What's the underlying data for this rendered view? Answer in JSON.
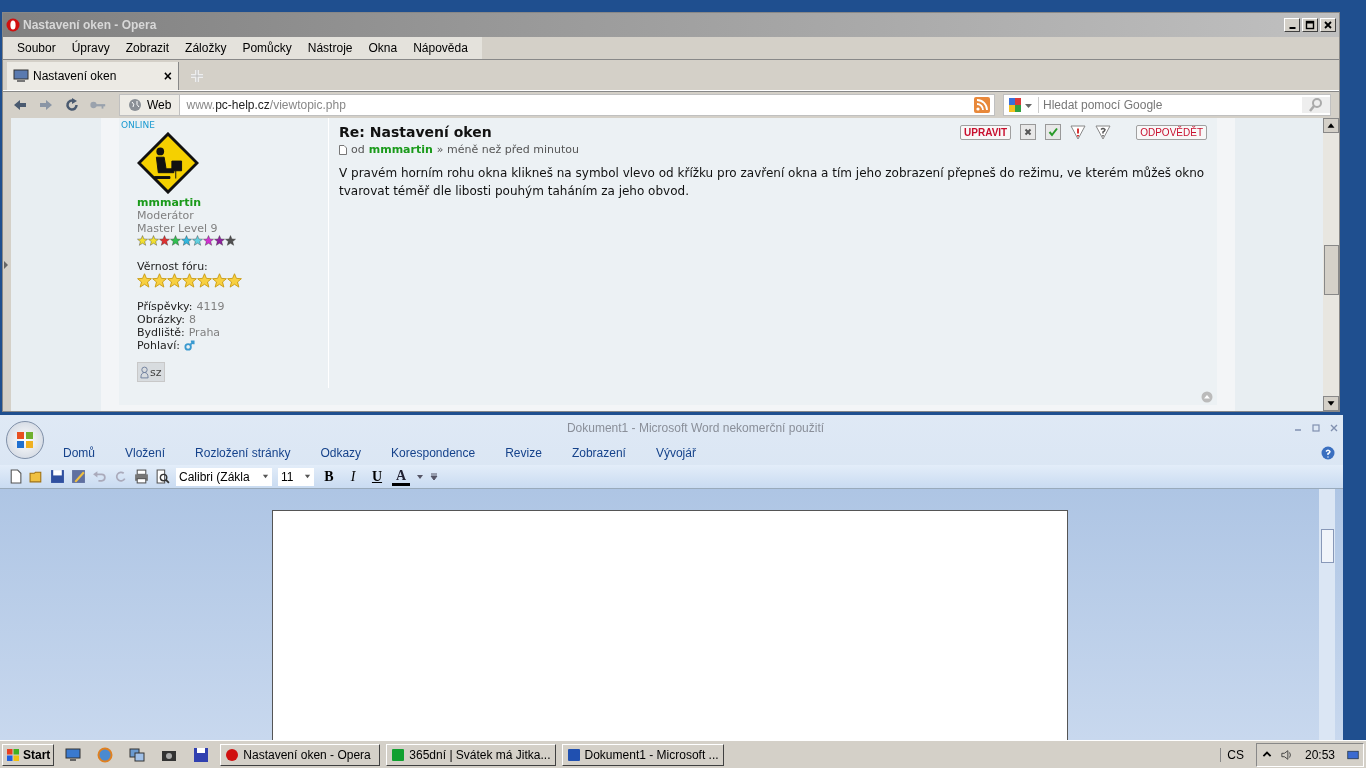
{
  "opera": {
    "title": "Nastavení oken - Opera",
    "menu": [
      "Soubor",
      "Úpravy",
      "Zobrazit",
      "Záložky",
      "Pomůcky",
      "Nástroje",
      "Okna",
      "Nápověda"
    ],
    "tab": {
      "label": "Nastavení oken",
      "close": "×"
    },
    "address": {
      "badge": "Web",
      "host_prefix": "www.",
      "host": "pc-help.cz",
      "path": "/viewtopic.php"
    },
    "search": {
      "placeholder": "Hledat pomocí Google"
    },
    "post": {
      "online": "ONLINE",
      "username": "mmmartin",
      "role": "Moderátor",
      "rank": "Master Level 9",
      "rank_stars": [
        {
          "color": "#f2e030"
        },
        {
          "color": "#f2e030"
        },
        {
          "color": "#e03030"
        },
        {
          "color": "#30c050"
        },
        {
          "color": "#30b8e0"
        },
        {
          "color": "#60d0e0"
        },
        {
          "color": "#d030d0"
        },
        {
          "color": "#9020a0"
        },
        {
          "color": "#505050"
        }
      ],
      "loyalty": {
        "label": "Věrnost fóru:",
        "stars": 7
      },
      "stats": [
        {
          "label": "Příspěvky:",
          "value": "4119"
        },
        {
          "label": "Obrázky:",
          "value": "8"
        },
        {
          "label": "Bydliště:",
          "value": "Praha"
        },
        {
          "label": "Pohlaví:"
        }
      ],
      "pm": "sz",
      "edit": "UPRAVIT",
      "reply": "ODPOVĚDĚT",
      "title": "Re: Nastavení oken",
      "meta": {
        "by": "od",
        "author": "mmmartin",
        "sep": "»",
        "time": "méně než před minutou"
      },
      "body": "V pravém horním rohu okna klikneš na symbol vlevo od křížku pro zavření okna a tím jeho zobrazení přepneš do režimu, ve kterém můžeš okno tvarovat téměř dle libosti pouhým taháním za jeho obvod."
    }
  },
  "word": {
    "title": "Dokument1 - Microsoft Word nekomerční použití",
    "tabs": [
      "Domů",
      "Vložení",
      "Rozložení stránky",
      "Odkazy",
      "Korespondence",
      "Revize",
      "Zobrazení",
      "Vývojář"
    ],
    "font": "Calibri (Zákla",
    "size": "11",
    "bold": "B",
    "italic": "I",
    "underline": "U",
    "font_color_letter": "A"
  },
  "taskbar": {
    "start": "Start",
    "tasks": [
      {
        "label": "Nastavení oken - Opera",
        "kind": "opera",
        "selected": false
      },
      {
        "label": "365dní | Svátek má Jitka...",
        "kind": "green",
        "selected": false
      },
      {
        "label": "Dokument1 - Microsoft ...",
        "kind": "word",
        "selected": false
      }
    ],
    "lang": "CS",
    "clock": "20:53"
  }
}
